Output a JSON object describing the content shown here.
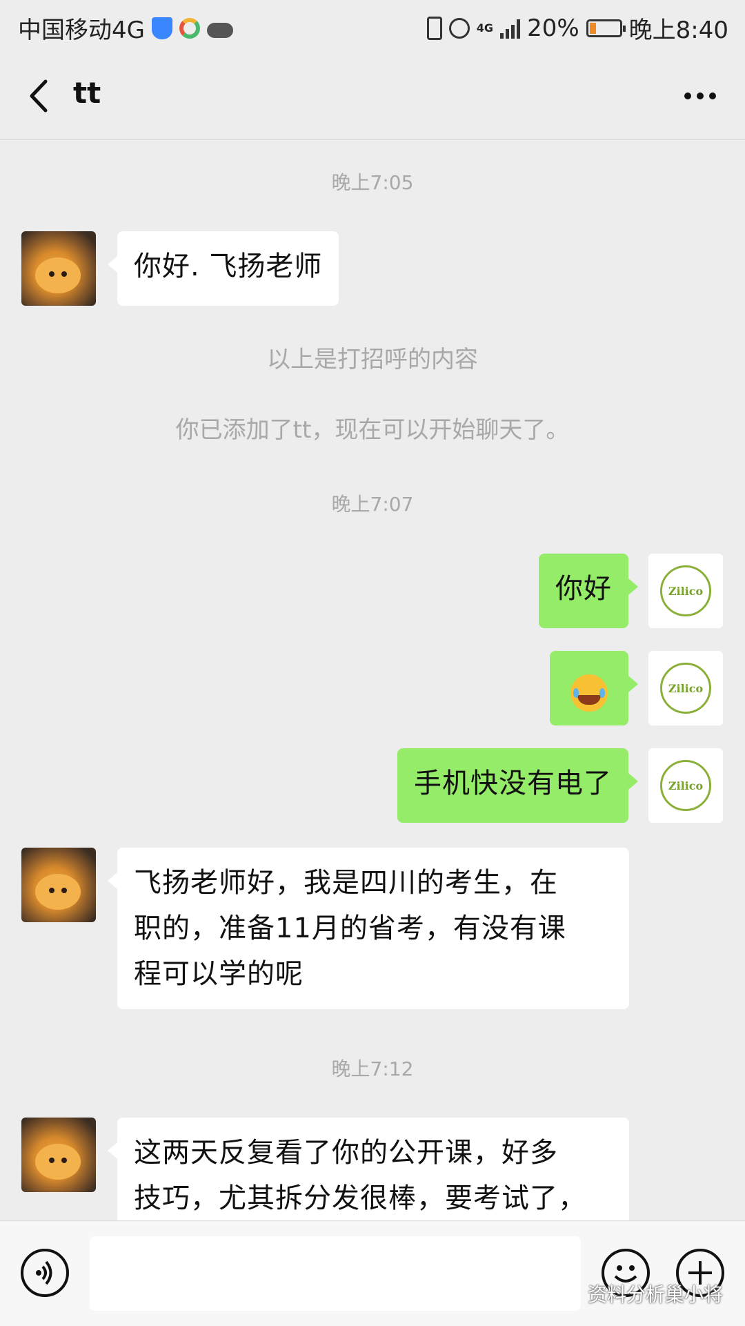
{
  "status_bar": {
    "carrier": "中国移动4G",
    "network_small": "4G",
    "battery_percent": "20%",
    "time": "晚上8:40"
  },
  "header": {
    "title": "tt"
  },
  "messages": {
    "time_1": "晚上7:05",
    "in_1": "你好. 飞扬老师",
    "note_1": "以上是打招呼的内容",
    "note_2": "你已添加了tt，现在可以开始聊天了。",
    "time_2": "晚上7:07",
    "out_1": "你好",
    "out_2_emoji": "😂",
    "out_3": "手机快没有电了",
    "in_2_line1": "飞扬老师好，我是四川的考生，在",
    "in_2_line2": "职的，准备11月的省考，有没有课",
    "in_2_line3": "程可以学的呢",
    "time_3": "晚上7:12",
    "in_3_line1": "这两天反复看了你的公开课，好多",
    "in_3_line2": "技巧，尤其拆分发很棒，要考试了，"
  },
  "avatars": {
    "me_logo_text": "Zilico"
  },
  "input_bar": {
    "value": ""
  },
  "watermark": "资料分析巢小将",
  "colors": {
    "outgoing_bubble": "#95ec69",
    "incoming_bubble": "#ffffff",
    "background": "#ededed"
  }
}
